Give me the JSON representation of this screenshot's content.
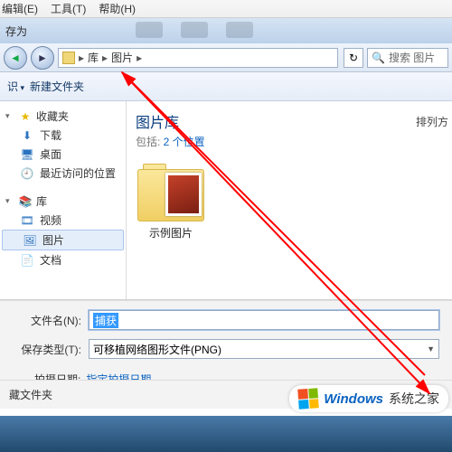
{
  "menu": {
    "edit": "编辑(E)",
    "tools": "工具(T)",
    "help": "帮助(H)"
  },
  "title": "存为",
  "breadcrumb": {
    "root": "库",
    "sub": "图片"
  },
  "search": {
    "placeholder": "搜索 图片"
  },
  "toolbar": {
    "organize": "识",
    "newfolder": "新建文件夹"
  },
  "sidebar": {
    "fav": {
      "label": "收藏夹"
    },
    "downloads": "下载",
    "desktop": "桌面",
    "recent": "最近访问的位置",
    "libs": {
      "label": "库"
    },
    "videos": "视频",
    "pictures": "图片",
    "docs": "文档"
  },
  "content": {
    "title": "图片库",
    "subPrefix": "包括: ",
    "subLink": "2 个位置",
    "sort": "排列方",
    "sampleFolder": "示例图片"
  },
  "fields": {
    "filenameLabel": "文件名(N):",
    "filenameValue": "捕获",
    "typeLabel": "保存类型(T):",
    "typeValue": "可移植网络图形文件(PNG)",
    "dateLabel": "拍摄日期:",
    "dateLink": "指定拍摄日期"
  },
  "bottom": {
    "hide": "藏文件夹"
  },
  "watermark": {
    "brand": "Windows",
    "sub": "系统之家"
  }
}
